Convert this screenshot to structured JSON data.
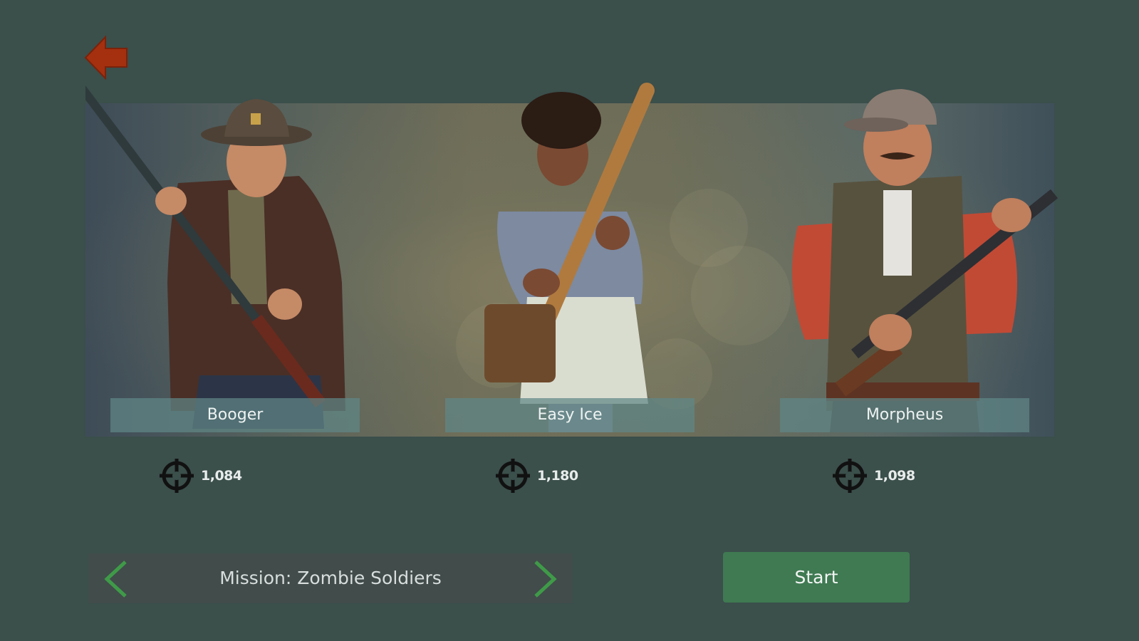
{
  "characters": [
    {
      "name": "Booger",
      "score": "1,084"
    },
    {
      "name": "Easy Ice",
      "score": "1,180"
    },
    {
      "name": "Morpheus",
      "score": "1,098"
    }
  ],
  "mission": {
    "label": "Mission: Zombie Soldiers"
  },
  "start_label": "Start",
  "icons": {
    "back": "back-arrow-icon",
    "score": "crosshair-icon",
    "prev": "chevron-left-icon",
    "next": "chevron-right-icon"
  },
  "colors": {
    "background": "#3b4f4b",
    "back_arrow": "#a4300f",
    "start_button": "#3f7a52",
    "chevrons": "#3f9a48",
    "name_plate": "#5f8787"
  }
}
